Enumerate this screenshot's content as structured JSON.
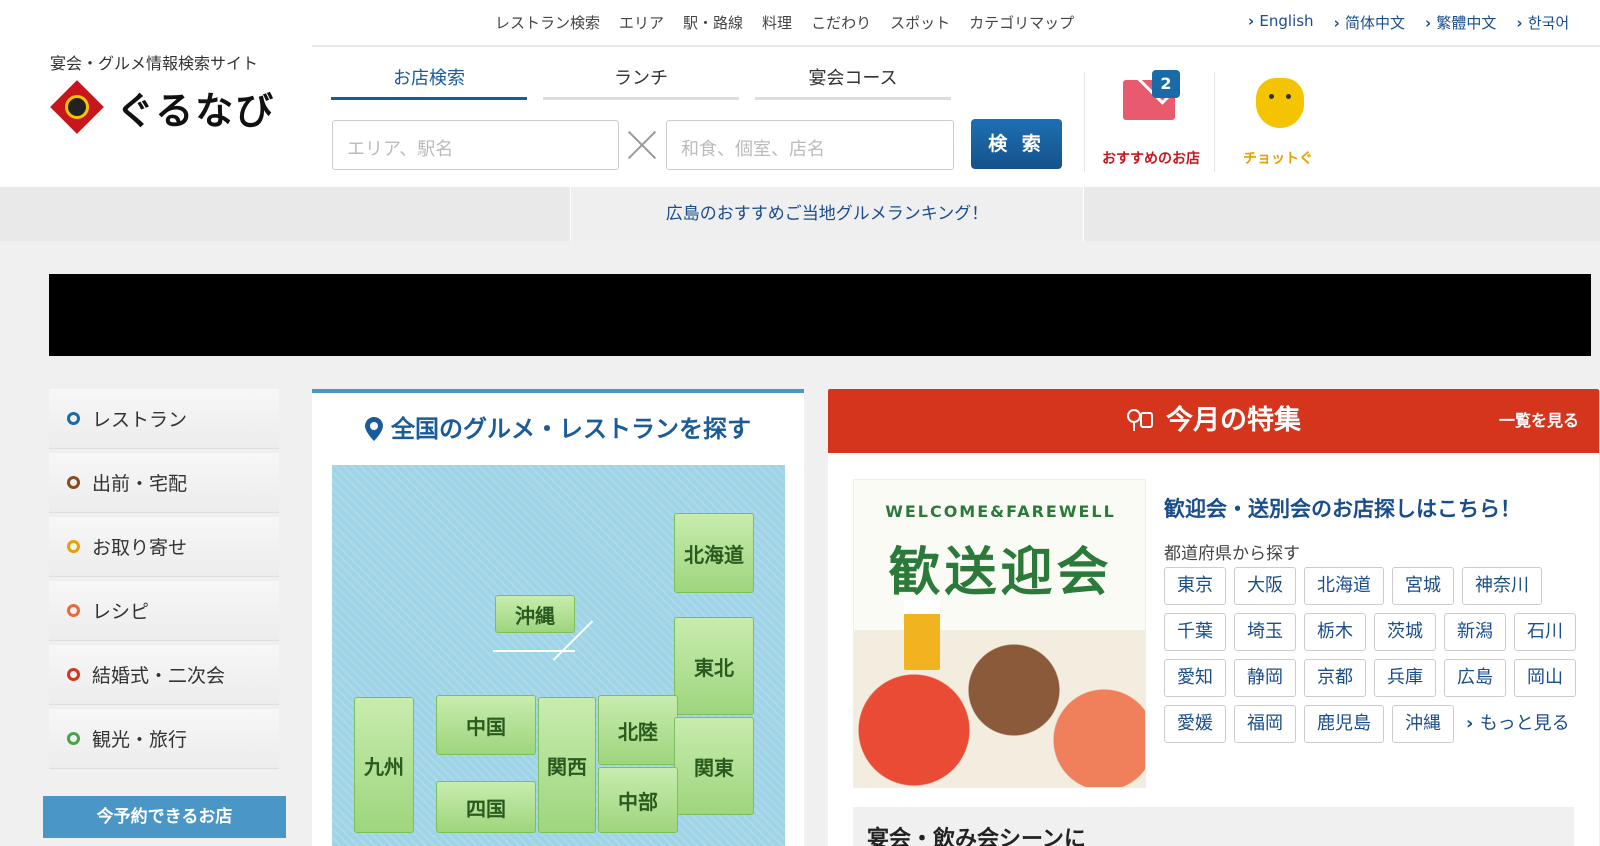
{
  "header": {
    "tagline": "宴会・グルメ情報検索サイト",
    "logo_text": "ぐるなび",
    "topnav": [
      "レストラン検索",
      "エリア",
      "駅・路線",
      "料理",
      "こだわり",
      "スポット",
      "カテゴリマップ"
    ],
    "languages": [
      "English",
      "简体中文",
      "繁體中文",
      "한국어"
    ]
  },
  "search": {
    "tabs": [
      {
        "label": "お店検索",
        "active": true
      },
      {
        "label": "ランチ",
        "active": false
      },
      {
        "label": "宴会コース",
        "active": false
      }
    ],
    "area_placeholder": "エリア、駅名",
    "keyword_placeholder": "和食、個室、店名",
    "button_label": "検 索"
  },
  "recommend": {
    "label": "おすすめのお店",
    "badge": "2"
  },
  "chotto": {
    "label": "チョットぐ"
  },
  "banner": {
    "text": "広島のおすすめご当地グルメランキング！"
  },
  "sidebar": {
    "items": [
      {
        "label": "レストラン",
        "color": "#1a6aa8"
      },
      {
        "label": "出前・宅配",
        "color": "#8a4a1f"
      },
      {
        "label": "お取り寄せ",
        "color": "#e6a100"
      },
      {
        "label": "レシピ",
        "color": "#e86a3a"
      },
      {
        "label": "結婚式・二次会",
        "color": "#d4351c"
      },
      {
        "label": "観光・旅行",
        "color": "#4aa34a"
      }
    ],
    "reserve_label": "今予約できるお店"
  },
  "map": {
    "title": "全国のグルメ・レストランを探す",
    "regions": [
      "北海道",
      "沖縄",
      "東北",
      "中国",
      "北陸",
      "関東",
      "九州",
      "関西",
      "四国",
      "中部"
    ]
  },
  "feature": {
    "heading": "今月の特集",
    "view_all": "一覧を見る",
    "image_welcome": "WELCOME&FAREWELL",
    "image_kanji": "歓送迎会",
    "title": "歓迎会・送別会のお店探しはこちら！",
    "subtitle": "都道府県から探す",
    "prefectures": [
      "東京",
      "大阪",
      "北海道",
      "宮城",
      "神奈川",
      "千葉",
      "埼玉",
      "栃木",
      "茨城",
      "新潟",
      "石川",
      "愛知",
      "静岡",
      "京都",
      "兵庫",
      "広島",
      "岡山",
      "愛媛",
      "福岡",
      "鹿児島",
      "沖縄"
    ],
    "more_label": "もっと見る",
    "scene_title": "宴会・飲み会シーンに"
  }
}
